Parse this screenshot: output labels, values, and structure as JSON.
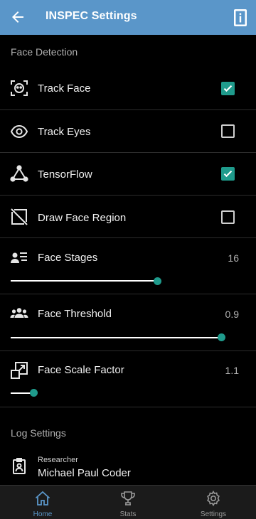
{
  "app_bar": {
    "title": "INSPEC Settings",
    "back_icon": "arrow-left-icon",
    "info_icon": "info-icon",
    "color": "#5a96c9"
  },
  "face_detection": {
    "header": "Face Detection",
    "items": [
      {
        "label": "Track Face",
        "icon": "face-scan-icon",
        "checked": true
      },
      {
        "label": "Track Eyes",
        "icon": "eye-icon",
        "checked": false
      },
      {
        "label": "TensorFlow",
        "icon": "network-graph-icon",
        "checked": true
      },
      {
        "label": "Draw Face Region",
        "icon": "crop-off-icon",
        "checked": false
      }
    ],
    "sliders": [
      {
        "label": "Face Stages",
        "icon": "people-list-icon",
        "value": "16",
        "level": 0.69
      },
      {
        "label": "Face Threshold",
        "icon": "group-icon",
        "value": "0.9",
        "level": 0.99
      },
      {
        "label": "Face Scale Factor",
        "icon": "scale-icon",
        "value": "1.1",
        "level": 0.11
      }
    ]
  },
  "log_settings": {
    "header": "Log Settings",
    "researcher_label": "Researcher",
    "researcher_name": "Michael Paul Coder",
    "icon": "badge-icon"
  },
  "bottom_nav": {
    "items": [
      {
        "label": "Home",
        "icon": "home-icon",
        "active": true
      },
      {
        "label": "Stats",
        "icon": "trophy-icon",
        "active": false
      },
      {
        "label": "Settings",
        "icon": "gear-icon",
        "active": false
      }
    ]
  },
  "colors": {
    "accent": "#1f9b8c",
    "primary": "#5a96c9",
    "background": "#000000"
  }
}
